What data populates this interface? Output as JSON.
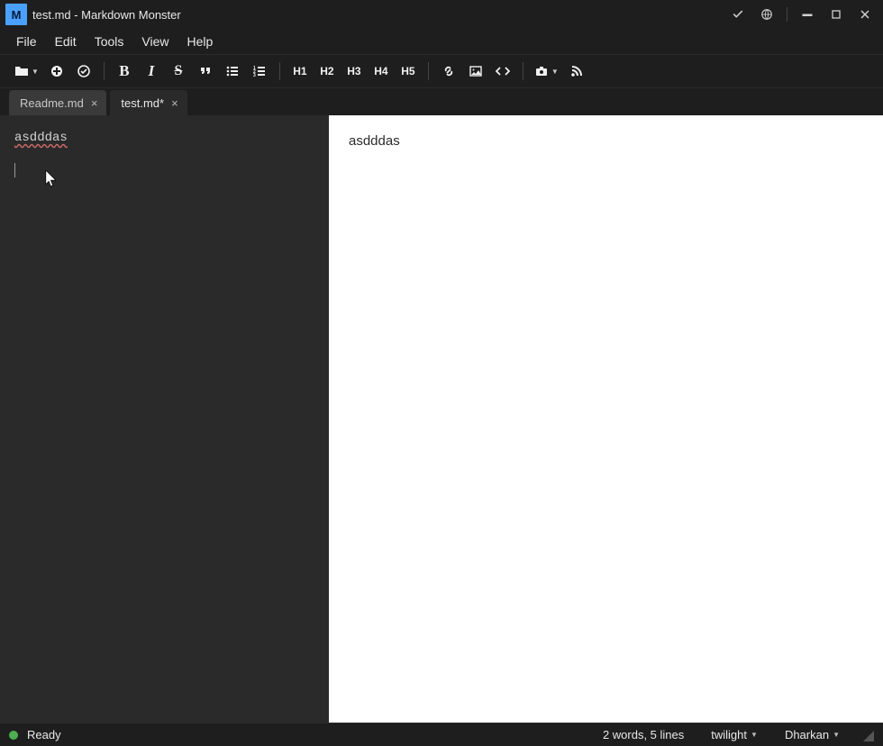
{
  "title": "test.md  - Markdown Monster",
  "menu": [
    "File",
    "Edit",
    "Tools",
    "View",
    "Help"
  ],
  "toolbar": {
    "h1": "H1",
    "h2": "H2",
    "h3": "H3",
    "h4": "H4",
    "h5": "H5"
  },
  "tabs": [
    {
      "label": "Readme.md",
      "active": false
    },
    {
      "label": "test.md*",
      "active": true
    }
  ],
  "editor": {
    "content": "asdddas"
  },
  "preview": {
    "content": "asdddas"
  },
  "status": {
    "ready": "Ready",
    "stats": "2 words, 5 lines",
    "theme": "twilight",
    "previewTheme": "Dharkan"
  }
}
